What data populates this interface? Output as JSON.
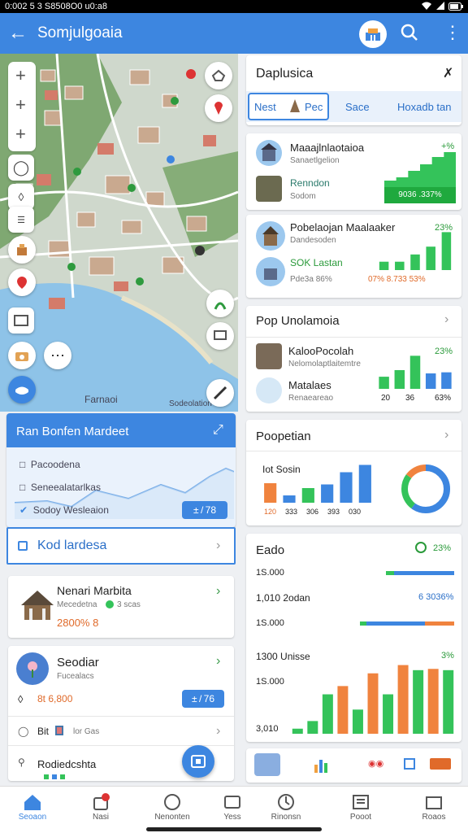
{
  "status_bar": {
    "time": "0:002 5 3 S8508O0 u0:a8"
  },
  "app_bar": {
    "title": "Somjulgoaia"
  },
  "map": {
    "label_water": "Farnaoi",
    "label_corner": "Sodeolation"
  },
  "left_panel": {
    "title": "Ran Bonfen Mardeet",
    "rows": [
      "Pacoodena",
      "Seneealatarlkas",
      "Sodoy Wesleaion"
    ],
    "badge": "± / 78",
    "highlight": "Kod lardesa"
  },
  "left_cards": [
    {
      "title": "Nenari Marbita",
      "subtitle": "Mecedetna",
      "tag": "3 scas",
      "value": "2800% 8"
    },
    {
      "title": "Seodiar",
      "subtitle": "Fucealacs",
      "value": "8t 6,800",
      "badge": "± / 76"
    }
  ],
  "left_list": [
    {
      "label": "Bit",
      "extra": "lor Gas"
    },
    {
      "label": "Rodiedcshta"
    }
  ],
  "right_header": {
    "title": "Daplusica",
    "tabs": [
      "Nest",
      "Pec",
      "Sace",
      "Hoxadb tan"
    ]
  },
  "right_cards": [
    {
      "title": "Maaajlnlaotaioa",
      "sub1": "Sanaetlgelion",
      "sub2": "Renndon",
      "sub3": "Sodom",
      "pct": "+%",
      "chip": "9036 .337%"
    },
    {
      "title": "Pobelaojan Maalaaker",
      "sub1": "Dandesoden",
      "sub2": "SOK Lastan",
      "sub3": "Pde3a 86%",
      "pct": "23%",
      "foot": [
        "07% 8.733 53%"
      ]
    },
    {
      "title": "Pop Unolamoia",
      "sub1": "KalooPocolah",
      "sub2": "Nelomolaptlaitemtre",
      "sub3": "Matalaes",
      "sub4": "Renaeareao",
      "pct": "23%",
      "foot": [
        "20",
        "36",
        "63%"
      ]
    },
    {
      "title": "Poopetian",
      "sub1": "Iot Sosin",
      "axis": [
        "120",
        "333",
        "306",
        "393",
        "030"
      ]
    },
    {
      "title": "Eado",
      "pct": "23%",
      "rows": [
        "1S.000",
        "1,010 2odan",
        "1S.000",
        "1300 Unisse",
        "1S.000",
        "3,010"
      ],
      "value": "6 3036%",
      "pct2": "3%"
    }
  ],
  "chart_data": [
    {
      "type": "bar",
      "title": "Maaajlnlaotaioa",
      "series": [
        {
          "name": "",
          "values": [
            20,
            28,
            44,
            60,
            78,
            90
          ]
        }
      ]
    },
    {
      "type": "bar",
      "title": "Pobelaojan Maalaaker",
      "categories": [
        "a",
        "b",
        "c",
        "d",
        "e"
      ],
      "values": [
        15,
        15,
        28,
        42,
        68
      ]
    },
    {
      "type": "bar",
      "title": "Pop Unolamoia",
      "categories": [
        "a",
        "b",
        "c",
        "d",
        "e"
      ],
      "values": [
        22,
        34,
        60,
        28,
        30
      ]
    },
    {
      "type": "bar",
      "title": "Poopetian",
      "categories": [
        "a",
        "b",
        "c",
        "d",
        "e",
        "f"
      ],
      "values": [
        32,
        12,
        24,
        30,
        50,
        62
      ]
    },
    {
      "type": "pie",
      "title": "Poopetian",
      "values": [
        60,
        25,
        15
      ]
    },
    {
      "type": "bar",
      "title": "Eado",
      "values": [
        8,
        20,
        62,
        75,
        38,
        95,
        62,
        108,
        100,
        102,
        100
      ]
    }
  ],
  "bottom_nav": [
    "Seoaon",
    "Nasi",
    "Nenonten",
    "Yess",
    "Rinonsn",
    "Pooot",
    "Roaos"
  ],
  "accent": "#3d86e0",
  "green": "#34c35a",
  "orange": "#f0833e"
}
